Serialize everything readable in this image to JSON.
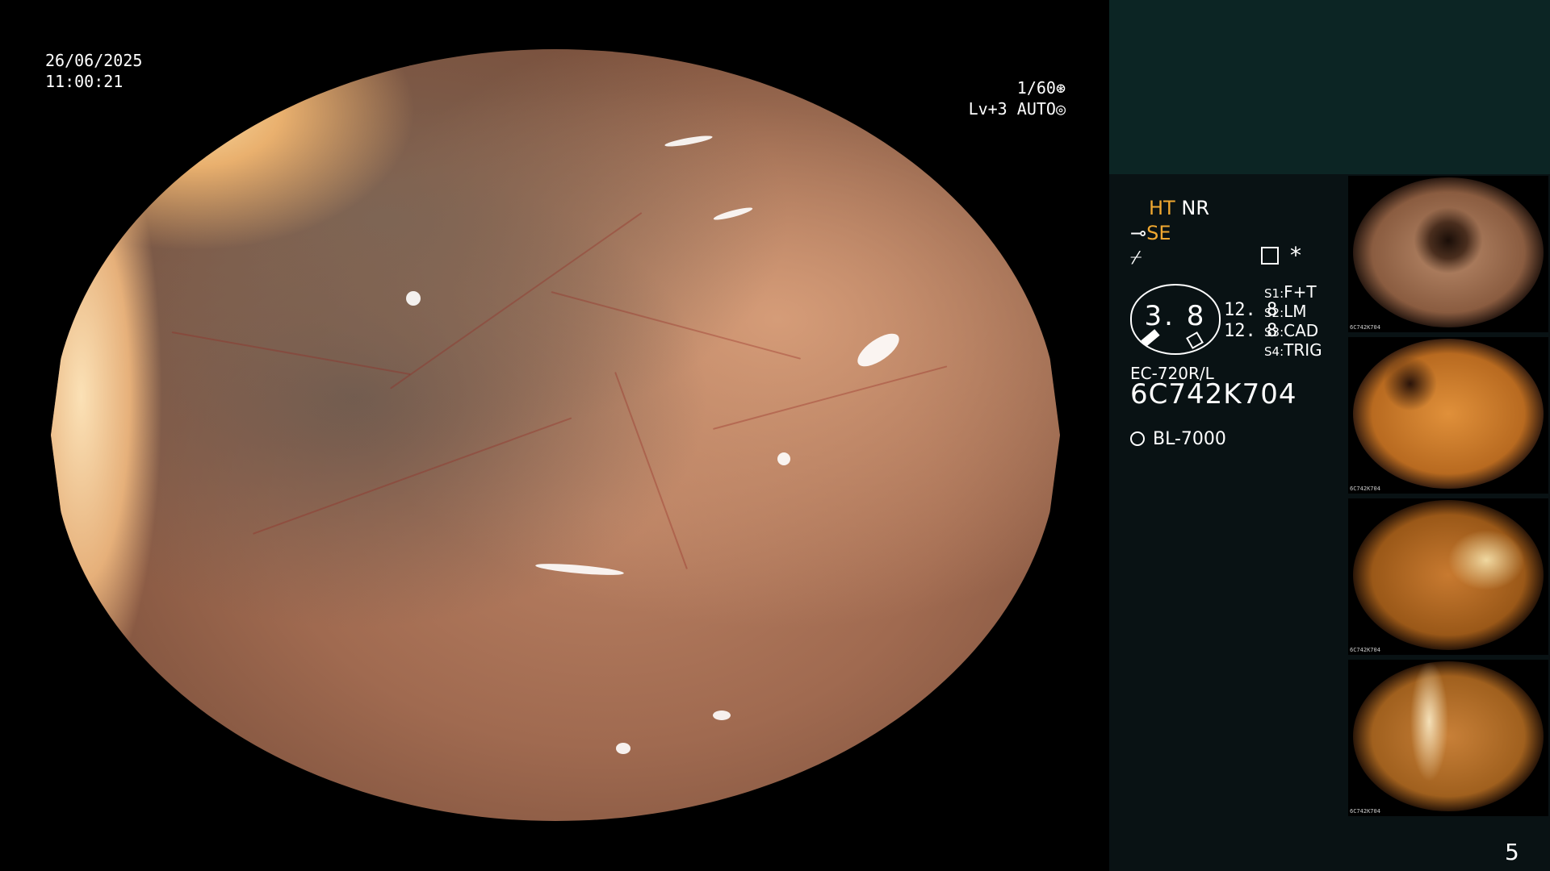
{
  "overlay": {
    "date": "26/06/2025",
    "time": "11:00:21",
    "shutter": "1/60",
    "shutter_icon": "shutter-icon",
    "level": "Lv+3",
    "mode": "AUTO",
    "mode_icon": "iris-icon"
  },
  "panel": {
    "ht": "HT",
    "nr": "NR",
    "se": "SE",
    "se_icon": "scope-icon",
    "fz_symbol": "⌿",
    "menu_icon": "menu-icon",
    "star": "*",
    "gauge_value": "3. 8",
    "num1": "12. 8",
    "num2": "12. 8",
    "s_rows": [
      {
        "key": "S1:",
        "value": "F+T"
      },
      {
        "key": "S2:",
        "value": "LM"
      },
      {
        "key": "S3:",
        "value": "CAD"
      },
      {
        "key": "S4:",
        "value": "TRIG"
      }
    ],
    "scope_model": "EC-720R/L",
    "serial": "6C742K704",
    "light_source": "BL-7000",
    "light_icon": "sun-icon",
    "accent_color": "#f0a830",
    "panel_bg": "#091214",
    "panel_top_bg": "#0c2524"
  },
  "thumbnails": [
    {
      "caption": "6C742K704"
    },
    {
      "caption": "6C742K704"
    },
    {
      "caption": "6C742K704"
    },
    {
      "caption": "6C742K704"
    }
  ],
  "page_number": "5"
}
